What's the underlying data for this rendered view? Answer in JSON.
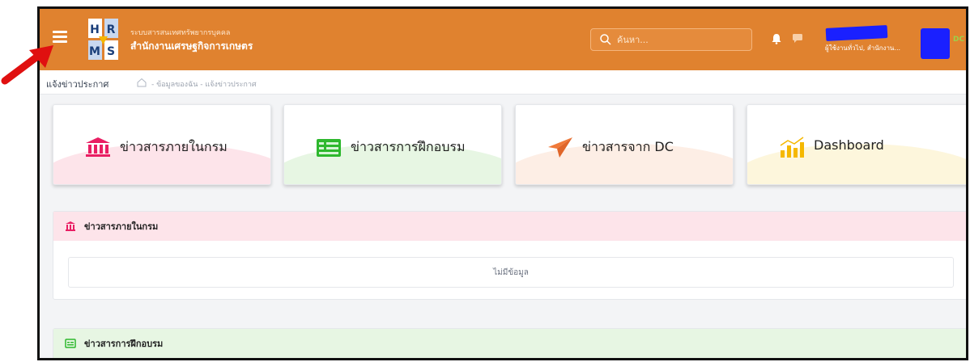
{
  "header": {
    "org_subtitle": "ระบบสารสนเทศทรัพยากรบุคคล",
    "org_title": "สำนักงานเศรษฐกิจการเกษตร",
    "search_placeholder": "ค้นหา...",
    "user_role": "ผู้ใช้งานทั่วไป, สำนักงาน...",
    "avatar_badge": "DC",
    "brand_color": "#e0822f"
  },
  "breadcrumb": {
    "title": "แจ้งข่าวประกาศ",
    "path": "- ข้อมูลของฉัน - แจ้งข่าวประกาศ"
  },
  "cards": [
    {
      "label": "ข่าวสารภายในกรม",
      "icon": "institution-icon",
      "color": "#e91e63"
    },
    {
      "label": "ข่าวสารการฝึกอบรม",
      "icon": "board-icon",
      "color": "#2eb82e"
    },
    {
      "label": "ข่าวสารจาก DC",
      "icon": "paper-plane-icon",
      "color": "#f07a3a"
    },
    {
      "label": "Dashboard",
      "icon": "bar-chart-icon",
      "color": "#f5b800"
    }
  ],
  "panels": [
    {
      "title": "ข่าวสารภายในกรม",
      "empty_text": "ไม่มีข้อมูล"
    },
    {
      "title": "ข่าวสารการฝึกอบรม"
    }
  ]
}
